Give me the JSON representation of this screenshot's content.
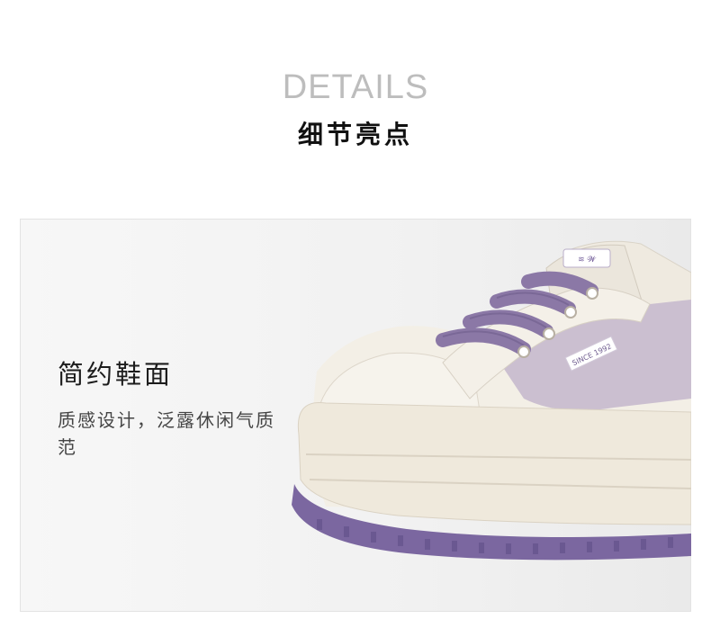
{
  "header": {
    "title_en": "DETAILS",
    "title_zh": "细节亮点"
  },
  "feature": {
    "title": "简约鞋面",
    "description": "质感设计，泛露休闲气质范"
  },
  "product_image": {
    "label_tag": "SINCE 1992",
    "colors": {
      "upper": "#f1ede3",
      "panel": "#cbbfd0",
      "lace": "#8b78a6",
      "sole_stripe": "#7b67a0"
    }
  }
}
